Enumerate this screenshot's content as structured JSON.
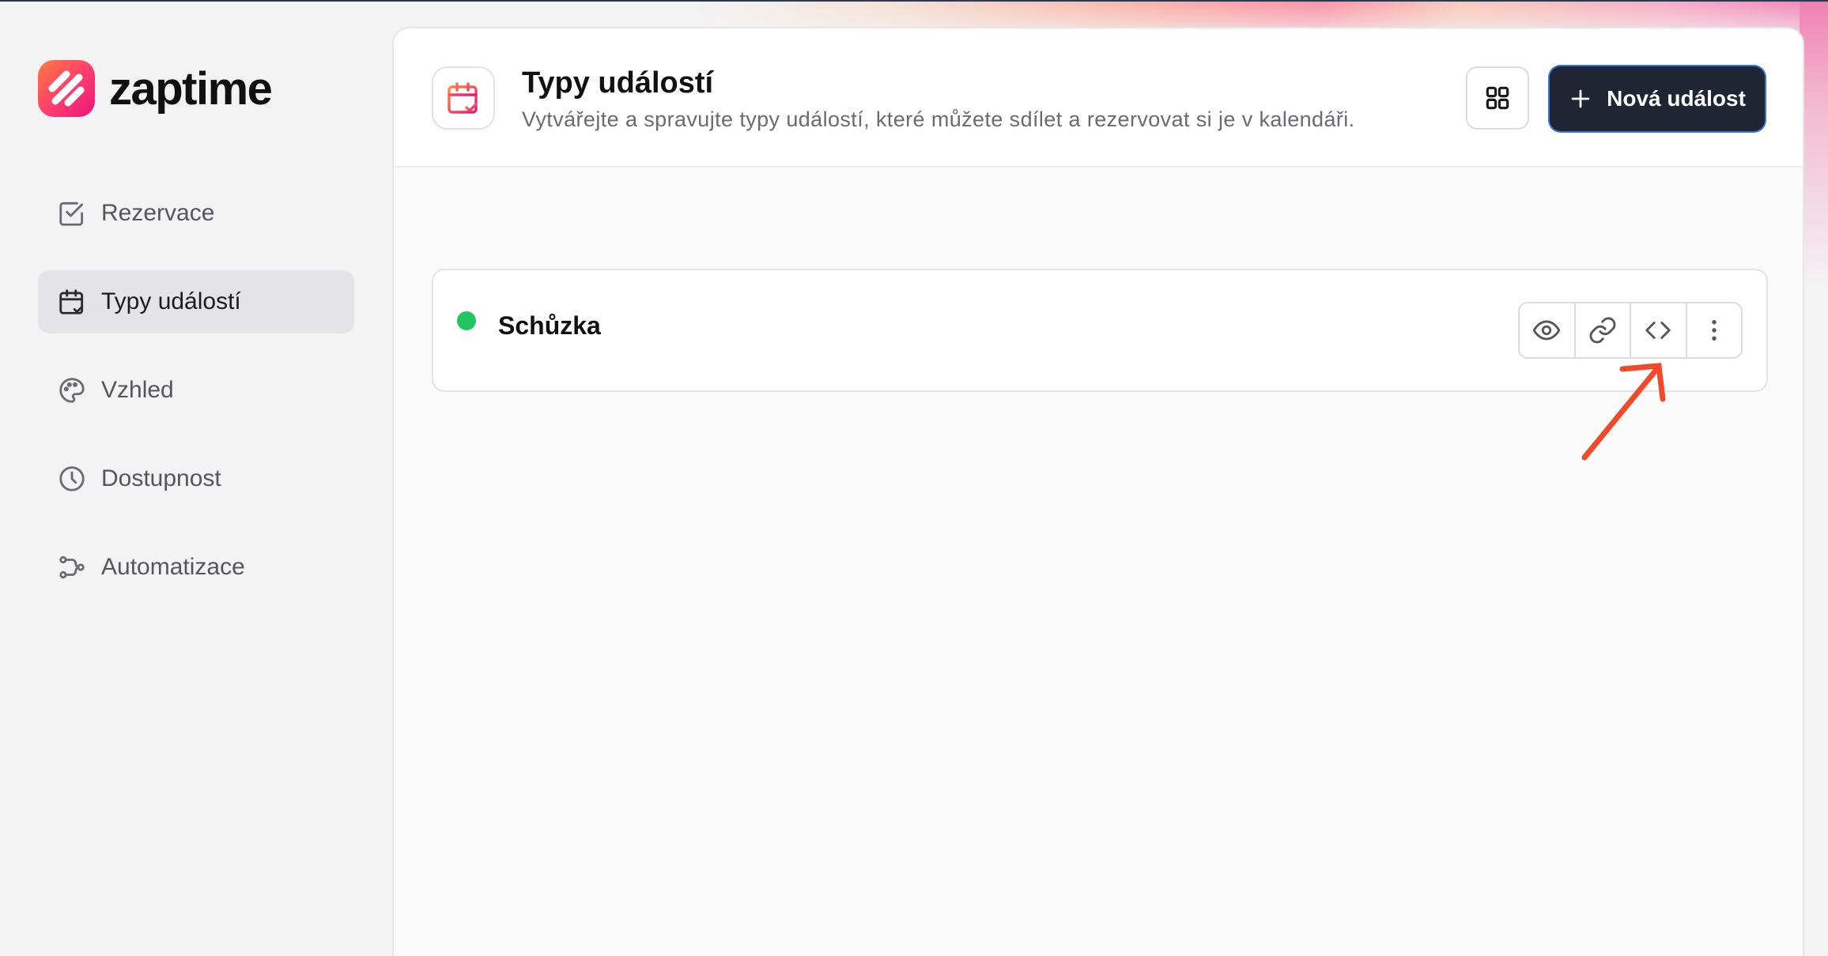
{
  "app": {
    "name": "zaptime"
  },
  "sidebar": {
    "items": [
      {
        "label": "Rezervace",
        "icon": "checkbox-icon",
        "active": false
      },
      {
        "label": "Typy událostí",
        "icon": "calendar-check-icon",
        "active": true
      },
      {
        "label": "Vzhled",
        "icon": "palette-icon",
        "active": false
      },
      {
        "label": "Dostupnost",
        "icon": "clock-icon",
        "active": false
      },
      {
        "label": "Automatizace",
        "icon": "workflow-icon",
        "active": false
      }
    ]
  },
  "header": {
    "title": "Typy událostí",
    "subtitle": "Vytvářejte a spravujte typy událostí, které můžete sdílet a rezervovat si je v kalendáři.",
    "new_button_label": "Nová událost"
  },
  "events": [
    {
      "name": "Schůzka",
      "status_color": "#22c55e"
    }
  ],
  "colors": {
    "accent": "#1f2533",
    "brand": "#ff3b6f",
    "arrow": "#f04a2a"
  }
}
